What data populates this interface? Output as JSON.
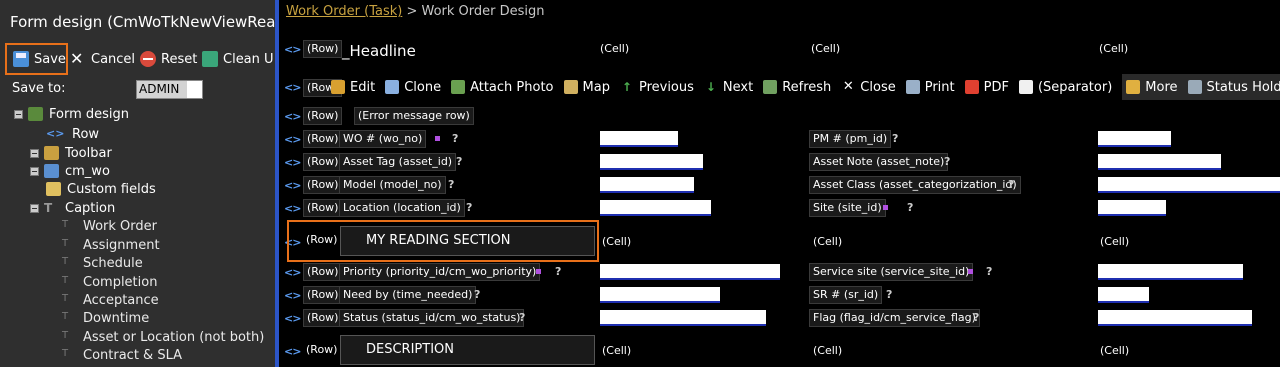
{
  "left_panel": {
    "title": "Form design (CmWoTkNewViewRead)",
    "toolbar": {
      "save": "Save",
      "cancel": "Cancel",
      "reset": "Reset",
      "clean": "Clean U"
    },
    "save_to_label": "Save to:",
    "save_to_value": "ADMIN",
    "tree": [
      {
        "label": "Form design"
      },
      {
        "label": "Row"
      },
      {
        "label": "Toolbar"
      },
      {
        "label": "cm_wo"
      },
      {
        "label": "Custom fields"
      },
      {
        "label": "Caption"
      },
      {
        "label": "Work Order"
      },
      {
        "label": "Assignment"
      },
      {
        "label": "Schedule"
      },
      {
        "label": "Completion"
      },
      {
        "label": "Acceptance"
      },
      {
        "label": "Downtime"
      },
      {
        "label": "Asset or Location (not both)"
      },
      {
        "label": "Contract & SLA"
      }
    ]
  },
  "breadcrumb": {
    "link": "Work Order (Task)",
    "rest": " > Work Order Design"
  },
  "common": {
    "row": "(Row)",
    "cell": "(Cell)",
    "arrows": "<>",
    "help": "?"
  },
  "headline": "_Headline",
  "toolbar": {
    "items": [
      "Edit",
      "Clone",
      "Attach Photo",
      "Map",
      "Previous",
      "Next",
      "Refresh",
      "Close",
      "Print",
      "PDF",
      "(Separator)"
    ],
    "more": "More",
    "status_holder": "Status Holder"
  },
  "error_row": "(Error message row)",
  "fields": {
    "wo_no": "WO # (wo_no)",
    "pm_id": "PM # (pm_id)",
    "asset_id": "Asset Tag (asset_id)",
    "asset_note": "Asset Note (asset_note)",
    "model_no": "Model (model_no)",
    "asset_class": "Asset Class (asset_categorization_id)",
    "location": "Location (location_id)",
    "site": "Site (site_id)",
    "priority": "Priority (priority_id/cm_wo_priority)",
    "service_site": "Service site (service_site_id)",
    "need_by": "Need by (time_needed)",
    "sr": "SR # (sr_id)",
    "status": "Status (status_id/cm_wo_status)",
    "flag": "Flag (flag_id/cm_service_flag)"
  },
  "sections": {
    "reading": "MY READING SECTION",
    "description": "DESCRIPTION"
  },
  "colors": {
    "left_bg": "#2f2f2f",
    "divider": "#2c55c8",
    "highlight": "#e8701a",
    "link": "#c8a240",
    "input_border": "#1f2fb0"
  }
}
